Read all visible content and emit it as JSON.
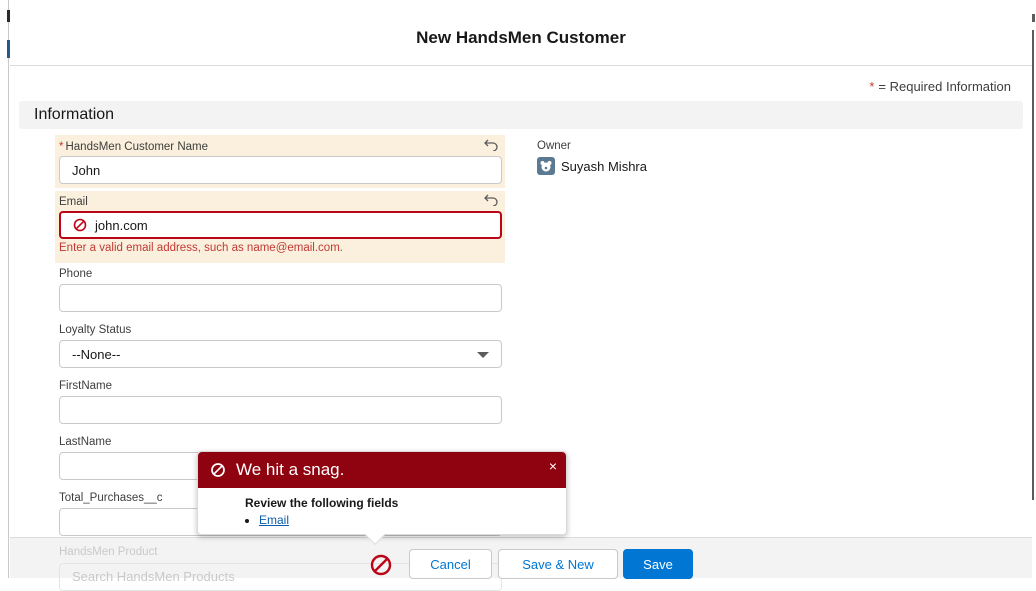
{
  "modal": {
    "title": "New HandsMen Customer",
    "required_legend_star": "*",
    "required_legend_text": "= Required Information"
  },
  "section": {
    "title": "Information"
  },
  "fields": {
    "name": {
      "required_mark": "*",
      "label": "HandsMen Customer Name",
      "value": "John"
    },
    "email": {
      "label": "Email",
      "value": "john.com",
      "error": "Enter a valid email address, such as name@email.com."
    },
    "phone": {
      "label": "Phone",
      "value": ""
    },
    "loyalty": {
      "label": "Loyalty Status",
      "value": "--None--"
    },
    "first_name": {
      "label": "FirstName",
      "value": ""
    },
    "last_name": {
      "label": "LastName",
      "value": ""
    },
    "total_purchases": {
      "label": "Total_Purchases__c",
      "value": ""
    },
    "product": {
      "label": "HandsMen Product",
      "placeholder": "Search HandsMen Products"
    }
  },
  "owner": {
    "label": "Owner",
    "name": "Suyash Mishra"
  },
  "error_popover": {
    "title": "We hit a snag.",
    "close_glyph": "×",
    "heading": "Review the following fields",
    "fields": [
      "Email"
    ]
  },
  "footer": {
    "cancel_label": "Cancel",
    "save_new_label": "Save & New",
    "save_label": "Save"
  },
  "colors": {
    "brand": "#0176d3",
    "error": "#ba0517",
    "edited_bg": "#faf0dd",
    "snag_header": "#8e030f"
  },
  "icons": [
    "undo-icon",
    "error-icon",
    "avatar-icon",
    "chevron-down-icon",
    "close-icon"
  ]
}
